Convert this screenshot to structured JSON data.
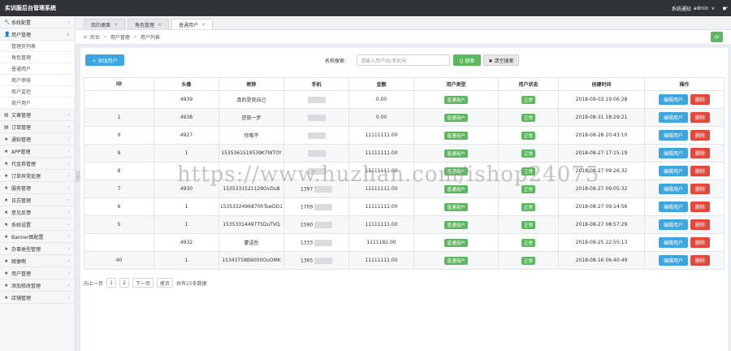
{
  "app": {
    "title": "实训服后台管理系统"
  },
  "topbar": {
    "notice_label": "系统通知",
    "user_label": "admin",
    "user_caret": "∨",
    "settings_glyph": "☛"
  },
  "sidebar": {
    "items": [
      {
        "icon": "🔧",
        "label": "系统配置",
        "arrow": "‹"
      },
      {
        "icon": "👤",
        "label": "用户管理",
        "arrow": "∨"
      }
    ],
    "subitems": [
      "管理员列表",
      "角色管理",
      "普通用户",
      "商户审核",
      "商户监控",
      "商户用户"
    ],
    "items_after": [
      {
        "icon": "▤",
        "label": "文章管理",
        "arrow": "‹"
      },
      {
        "icon": "▤",
        "label": "订单管理",
        "arrow": "‹"
      },
      {
        "icon": "★",
        "label": "通知管理",
        "arrow": "‹"
      },
      {
        "icon": "★",
        "label": "APP管理",
        "arrow": "‹"
      },
      {
        "icon": "★",
        "label": "代金券管理",
        "arrow": "‹"
      },
      {
        "icon": "★",
        "label": "订单异常处理",
        "arrow": "‹"
      },
      {
        "icon": "★",
        "label": "服务管理",
        "arrow": "‹"
      },
      {
        "icon": "★",
        "label": "日志管理",
        "arrow": "‹"
      },
      {
        "icon": "★",
        "label": "意见反馈",
        "arrow": "‹"
      },
      {
        "icon": "★",
        "label": "系统设置",
        "arrow": "‹"
      },
      {
        "icon": "★",
        "label": "Banner图配置",
        "arrow": "‹"
      },
      {
        "icon": "★",
        "label": "办事类型管理",
        "arrow": "‹"
      },
      {
        "icon": "★",
        "label": "随便啊",
        "arrow": "‹"
      },
      {
        "icon": "★",
        "label": "用户管理",
        "arrow": "‹"
      },
      {
        "icon": "★",
        "label": "添加修改管理",
        "arrow": "‹"
      },
      {
        "icon": "★",
        "label": "店铺管理",
        "arrow": "‹"
      }
    ],
    "collapse_glyph": "‹"
  },
  "tabs": [
    {
      "label": "我的桌面",
      "close": "×"
    },
    {
      "label": "角色管理",
      "close": "×"
    },
    {
      "label": "普通用户",
      "close": "×"
    }
  ],
  "breadcrumb": {
    "home_icon": "⌂",
    "items": [
      "后台",
      "用户管理",
      "用户列表"
    ],
    "sep": ">",
    "refresh_glyph": "⟳"
  },
  "toolbar": {
    "add_label": "+ 添加用户",
    "search_label": "名称搜索:",
    "search_placeholder": "请输入用户ID/手机号",
    "search_button": "Q 搜索",
    "clear_button": "✖ 清空搜索"
  },
  "table": {
    "headers": [
      "ID",
      "头像",
      "昵称",
      "手机",
      "金额",
      "用户类型",
      "用户状态",
      "创建时间",
      "操作"
    ],
    "edit_label": "编辑用户",
    "delete_label": "删除",
    "rows": [
      {
        "id": "",
        "avatar": "4939",
        "nick": "真的是我自己",
        "phone": "",
        "amount": "0.00",
        "type": "普通用户",
        "status": "正常",
        "created": "2018-09-03 19:06:28"
      },
      {
        "id": "1",
        "avatar": "4938",
        "nick": "逆旅一步",
        "phone": "",
        "amount": "0.00",
        "type": "普通用户",
        "status": "正常",
        "created": "2018-08-31 18:29:21"
      },
      {
        "id": "0",
        "avatar": "4927",
        "nick": "你哦不",
        "phone": "",
        "amount": "11111111.00",
        "type": "普通用户",
        "status": "正常",
        "created": "2018-08-28 20:43:10"
      },
      {
        "id": "9",
        "avatar": "1",
        "nick": "1535361519539K7WT0Y",
        "phone": "",
        "amount": "11111111.00",
        "type": "普通用户",
        "status": "正常",
        "created": "2018-08-27 17:15:19"
      },
      {
        "id": "8",
        "avatar": "",
        "nick": "",
        "phone": "",
        "amount": "11111111.00",
        "type": "普通用户",
        "status": "正常",
        "created": "2018-08-27 09:26:32"
      },
      {
        "id": "7",
        "avatar": "4930",
        "nick": "1535331521129OvDu8",
        "phone": "1397",
        "amount": "11111111.00",
        "type": "普通用户",
        "status": "正常",
        "created": "2018-08-27 09:05:32"
      },
      {
        "id": "6",
        "avatar": "1",
        "nick": "1535332496870hTswDD1",
        "phone": "1709",
        "amount": "11111111.00",
        "type": "普通用户",
        "status": "正常",
        "created": "2018-08-27 09:14:56"
      },
      {
        "id": "5",
        "avatar": "1",
        "nick": "1535331449775DuTVQ",
        "phone": "1590",
        "amount": "11111111.00",
        "type": "普通用户",
        "status": "正常",
        "created": "2018-08-27 08:57:29"
      },
      {
        "id": "",
        "avatar": "4932",
        "nick": "蒙语哲",
        "phone": "1333",
        "amount": "1111182.00",
        "type": "普通用户",
        "status": "正常",
        "created": "2018-08-25 22:55:13"
      },
      {
        "id": "40",
        "avatar": "1",
        "nick": "15343758B9000OuOMK",
        "phone": "1365",
        "amount": "11111111.00",
        "type": "普通用户",
        "status": "正常",
        "created": "2018-08-16 06:40:49"
      }
    ]
  },
  "pager": {
    "prev_label": "向上一页",
    "pages": [
      "1",
      "2"
    ],
    "next_label": "下一页",
    "last_label": "尾页",
    "summary": "共有15条数据"
  },
  "watermark": "https://www.huzhan.com/ishop24075"
}
